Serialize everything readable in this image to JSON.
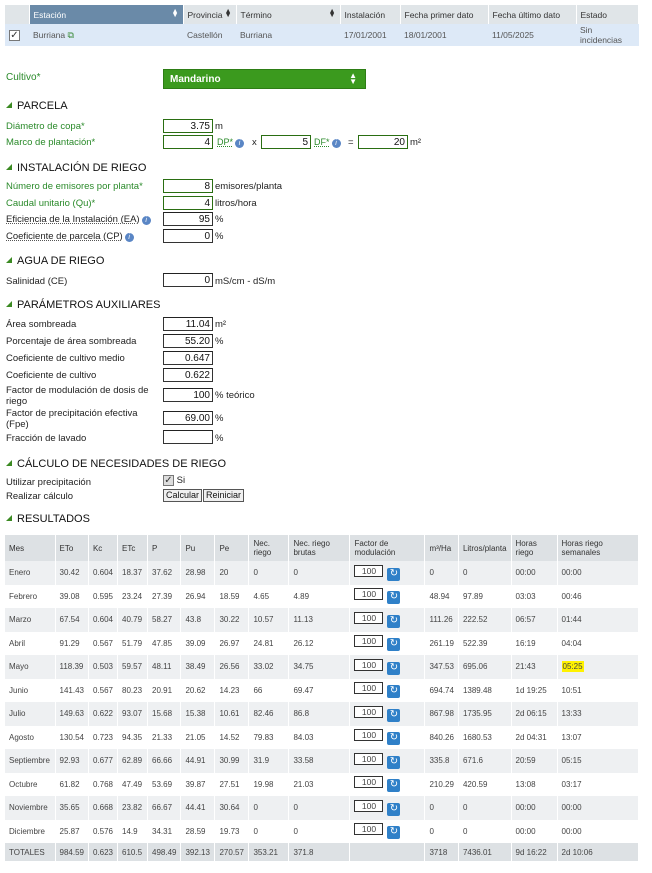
{
  "station": {
    "headers": [
      "Estación",
      "Provincia",
      "Término",
      "Instalación",
      "Fecha primer dato",
      "Fecha último dato",
      "Estado"
    ],
    "row": [
      "Burriana",
      "Castellón",
      "Burriana",
      "17/01/2001",
      "18/01/2001",
      "11/05/2025",
      "Sin incidencias"
    ]
  },
  "cultivo": {
    "label": "Cultivo*",
    "value": "Mandarino"
  },
  "parcela": {
    "title": "PARCELA",
    "diametro_label": "Diámetro de copa*",
    "diametro_value": "3.75",
    "diametro_unit": "m",
    "marco_label": "Marco de plantación*",
    "dp_value": "4",
    "dp_label": "DP*",
    "x": "x",
    "df_value": "5",
    "df_label": "DF*",
    "eq": "=",
    "area_value": "20",
    "area_unit": "m²"
  },
  "riego": {
    "title": "INSTALACIÓN DE RIEGO",
    "emisores_label": "Número de emisores por planta*",
    "emisores_value": "8",
    "emisores_unit": "emisores/planta",
    "caudal_label": "Caudal unitario (Qu)*",
    "caudal_value": "4",
    "caudal_unit": "litros/hora",
    "ea_label": "Eficiencia de la Instalación (EA)",
    "ea_value": "95",
    "ea_unit": "%",
    "cp_label": "Coeficiente de parcela (CP)",
    "cp_value": "0",
    "cp_unit": "%"
  },
  "agua": {
    "title": "AGUA DE RIEGO",
    "sal_label": "Salinidad (CE)",
    "sal_value": "0",
    "sal_unit": "mS/cm - dS/m"
  },
  "aux": {
    "title": "PARÁMETROS AUXILIARES",
    "area_label": "Área sombreada",
    "area_value": "11.04",
    "area_unit": "m²",
    "pct_label": "Porcentaje de área sombreada",
    "pct_value": "55.20",
    "pct_unit": "%",
    "kcm_label": "Coeficiente de cultivo medio",
    "kcm_value": "0.647",
    "kc_label": "Coeficiente de cultivo",
    "kc_value": "0.622",
    "fmod_label": "Factor de modulación de dosis de riego",
    "fmod_value": "100",
    "fmod_unit": "% teórico",
    "fpe_label": "Factor de precipitación efectiva (Fpe)",
    "fpe_value": "69.00",
    "fpe_unit": "%",
    "lav_label": "Fracción de lavado",
    "lav_value": "",
    "lav_unit": "%"
  },
  "calculo": {
    "title": "CÁLCULO DE NECESIDADES DE RIEGO",
    "precip_label": "Utilizar precipitación",
    "precip_check": "Si",
    "realizar_label": "Realizar cálculo",
    "calcular": "Calcular",
    "reiniciar": "Reiniciar"
  },
  "resultados": {
    "title": "RESULTADOS",
    "headers": [
      "Mes",
      "ETo",
      "Kc",
      "ETc",
      "P",
      "Pu",
      "Pe",
      "Nec. riego",
      "Nec. riego brutas",
      "Factor de modulación",
      "m³/Ha",
      "Litros/planta",
      "Horas riego",
      "Horas riego semanales"
    ],
    "rows": [
      [
        "Enero",
        "30.42",
        "0.604",
        "18.37",
        "37.62",
        "28.98",
        "20",
        "0",
        "0",
        "100",
        "0",
        "0",
        "00:00",
        "00:00"
      ],
      [
        "Febrero",
        "39.08",
        "0.595",
        "23.24",
        "27.39",
        "26.94",
        "18.59",
        "4.65",
        "4.89",
        "100",
        "48.94",
        "97.89",
        "03:03",
        "00:46"
      ],
      [
        "Marzo",
        "67.54",
        "0.604",
        "40.79",
        "58.27",
        "43.8",
        "30.22",
        "10.57",
        "11.13",
        "100",
        "111.26",
        "222.52",
        "06:57",
        "01:44"
      ],
      [
        "Abril",
        "91.29",
        "0.567",
        "51.79",
        "47.85",
        "39.09",
        "26.97",
        "24.81",
        "26.12",
        "100",
        "261.19",
        "522.39",
        "16:19",
        "04:04"
      ],
      [
        "Mayo",
        "118.39",
        "0.503",
        "59.57",
        "48.11",
        "38.49",
        "26.56",
        "33.02",
        "34.75",
        "100",
        "347.53",
        "695.06",
        "21:43",
        "05:25"
      ],
      [
        "Junio",
        "141.43",
        "0.567",
        "80.23",
        "20.91",
        "20.62",
        "14.23",
        "66",
        "69.47",
        "100",
        "694.74",
        "1389.48",
        "1d 19:25",
        "10:51"
      ],
      [
        "Julio",
        "149.63",
        "0.622",
        "93.07",
        "15.68",
        "15.38",
        "10.61",
        "82.46",
        "86.8",
        "100",
        "867.98",
        "1735.95",
        "2d 06:15",
        "13:33"
      ],
      [
        "Agosto",
        "130.54",
        "0.723",
        "94.35",
        "21.33",
        "21.05",
        "14.52",
        "79.83",
        "84.03",
        "100",
        "840.26",
        "1680.53",
        "2d 04:31",
        "13:07"
      ],
      [
        "Septiembre",
        "92.93",
        "0.677",
        "62.89",
        "66.66",
        "44.91",
        "30.99",
        "31.9",
        "33.58",
        "100",
        "335.8",
        "671.6",
        "20:59",
        "05:15"
      ],
      [
        "Octubre",
        "61.82",
        "0.768",
        "47.49",
        "53.69",
        "39.87",
        "27.51",
        "19.98",
        "21.03",
        "100",
        "210.29",
        "420.59",
        "13:08",
        "03:17"
      ],
      [
        "Noviembre",
        "35.65",
        "0.668",
        "23.82",
        "66.67",
        "44.41",
        "30.64",
        "0",
        "0",
        "100",
        "0",
        "0",
        "00:00",
        "00:00"
      ],
      [
        "Diciembre",
        "25.87",
        "0.576",
        "14.9",
        "34.31",
        "28.59",
        "19.73",
        "0",
        "0",
        "100",
        "0",
        "0",
        "00:00",
        "00:00"
      ]
    ],
    "totals": [
      "TOTALES",
      "984.59",
      "0.623",
      "610.5",
      "498.49",
      "392.13",
      "270.57",
      "353.21",
      "371.8",
      "",
      "3718",
      "7436.01",
      "9d 16:22",
      "2d 10:06"
    ]
  }
}
